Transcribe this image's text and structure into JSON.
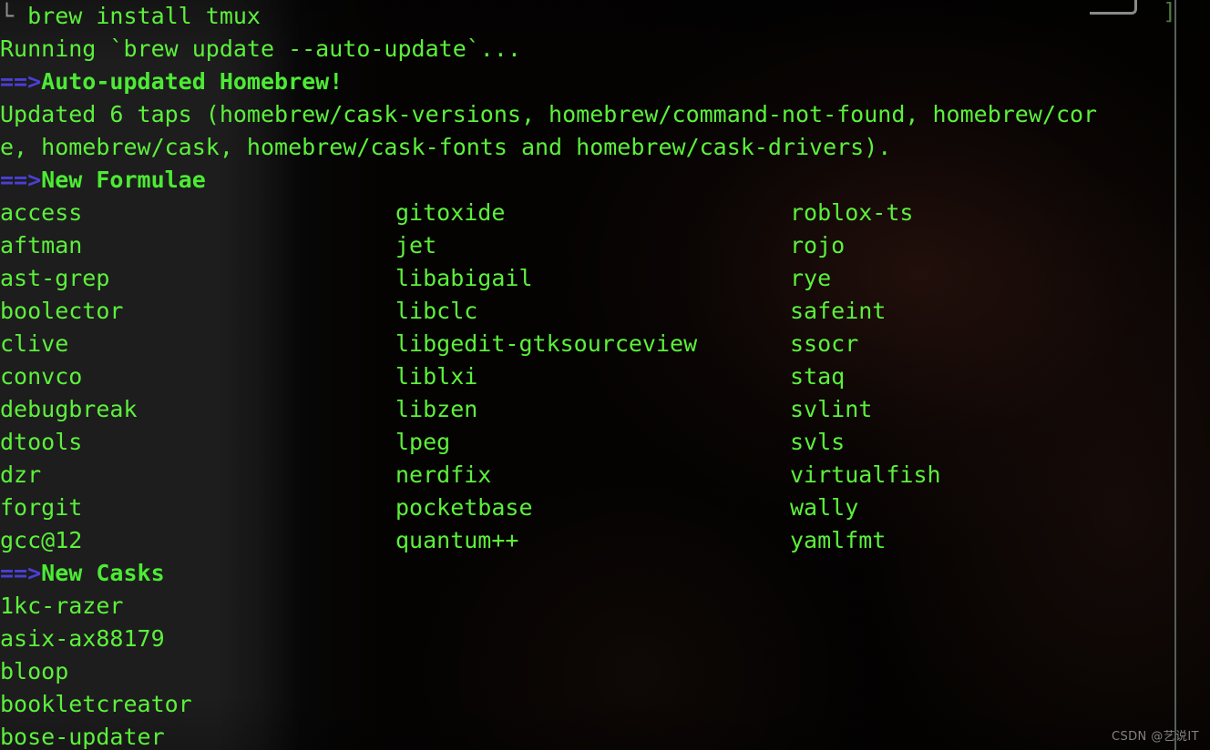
{
  "terminal": {
    "window_title": "brew install tmux",
    "colors": {
      "background": "#000000",
      "foreground_green": "#5cf03c",
      "heading_green": "#4ceb34",
      "arrow_blue": "#4b3fd6",
      "prompt_gray": "#8f8f8f",
      "divider_gray": "#55605a",
      "bracket_green": "#4e7a3a"
    },
    "chrome": {
      "prompt_glyph": "└",
      "bracket_glyph": "]"
    }
  },
  "session": {
    "command_line": {
      "prompt": "└",
      "command": " brew install tmux"
    },
    "lines": [
      "Running `brew update --auto-update`..."
    ],
    "auto_updated": {
      "arrow": "==>",
      "heading": "Auto-updated Homebrew!"
    },
    "taps_line_1": "Updated 6 taps (homebrew/cask-versions, homebrew/command-not-found, homebrew/cor",
    "taps_line_2": "e, homebrew/cask, homebrew/cask-fonts and homebrew/cask-drivers).",
    "new_formulae": {
      "arrow": "==>",
      "heading": "New Formulae",
      "columns": [
        [
          "access",
          "aftman",
          "ast-grep",
          "boolector",
          "clive",
          "convco",
          "debugbreak",
          "dtools",
          "dzr",
          "forgit",
          "gcc@12"
        ],
        [
          "gitoxide",
          "jet",
          "libabigail",
          "libclc",
          "libgedit-gtksourceview",
          "liblxi",
          "libzen",
          "lpeg",
          "nerdfix",
          "pocketbase",
          "quantum++"
        ],
        [
          "roblox-ts",
          "rojo",
          "rye",
          "safeint",
          "ssocr",
          "staq",
          "svlint",
          "svls",
          "virtualfish",
          "wally",
          "yamlfmt"
        ]
      ]
    },
    "new_casks": {
      "arrow": "==>",
      "heading": "New Casks",
      "items": [
        "1kc-razer",
        "asix-ax88179",
        "bloop",
        "bookletcreator",
        "bose-updater"
      ]
    }
  },
  "watermark": {
    "text": "CSDN @艺说IT"
  }
}
